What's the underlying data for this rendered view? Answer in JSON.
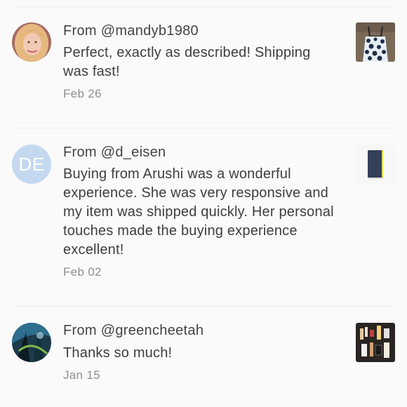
{
  "reviews": [
    {
      "author": "From @mandyb1980",
      "text": "Perfect, exactly as described! Shipping was fast!",
      "date": "Feb 26",
      "avatar": {
        "kind": "photo",
        "icon": "user-photo-blonde"
      },
      "thumbnail": {
        "icon": "dress-product-photo"
      }
    },
    {
      "author": "From @d_eisen",
      "text": "Buying from Arushi was a wonderful experience. She was very responsive and my item was shipped quickly. Her personal touches made the buying experience excellent!",
      "date": "Feb 02",
      "avatar": {
        "kind": "initials",
        "initials": "DE",
        "color": "#c4d9ef"
      },
      "thumbnail": {
        "icon": "notebook-product-photo"
      }
    },
    {
      "author": "From @greencheetah",
      "text": "Thanks so much!",
      "date": "Jan 15",
      "avatar": {
        "kind": "photo",
        "icon": "user-photo-abstract"
      },
      "thumbnail": {
        "icon": "cosmetics-product-photo"
      }
    }
  ]
}
